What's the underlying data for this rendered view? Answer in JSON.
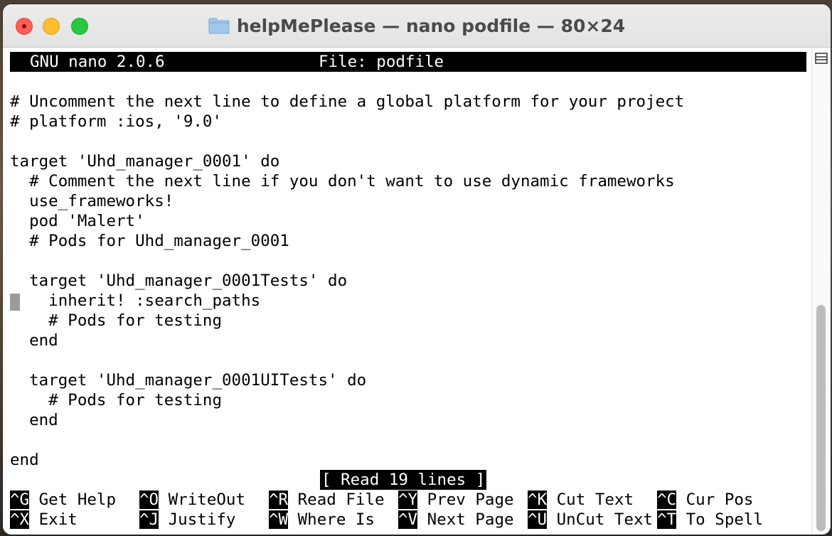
{
  "window": {
    "title": "helpMePlease — nano podfile — 80×24"
  },
  "nano": {
    "version": "GNU nano 2.0.6",
    "file": "File: podfile",
    "lines": [
      "",
      "# Uncomment the next line to define a global platform for your project",
      "# platform :ios, '9.0'",
      "",
      "target 'Uhd_manager_0001' do",
      "  # Comment the next line if you don't want to use dynamic frameworks",
      "  use_frameworks!",
      "  pod 'Malert'",
      "  # Pods for Uhd_manager_0001",
      "",
      "  target 'Uhd_manager_0001Tests' do",
      "    inherit! :search_paths",
      "    # Pods for testing",
      "  end",
      "",
      "  target 'Uhd_manager_0001UITests' do",
      "    # Pods for testing",
      "  end",
      "",
      "end"
    ],
    "status": "[ Read 19 lines ]",
    "shortcuts_row1": [
      {
        "key": "^G",
        "label": "Get Help"
      },
      {
        "key": "^O",
        "label": "WriteOut"
      },
      {
        "key": "^R",
        "label": "Read File"
      },
      {
        "key": "^Y",
        "label": "Prev Page"
      },
      {
        "key": "^K",
        "label": "Cut Text"
      },
      {
        "key": "^C",
        "label": "Cur Pos"
      }
    ],
    "shortcuts_row2": [
      {
        "key": "^X",
        "label": "Exit"
      },
      {
        "key": "^J",
        "label": "Justify"
      },
      {
        "key": "^W",
        "label": "Where Is"
      },
      {
        "key": "^V",
        "label": "Next Page"
      },
      {
        "key": "^U",
        "label": "UnCut Text"
      },
      {
        "key": "^T",
        "label": "To Spell"
      }
    ]
  },
  "colors": {
    "close": "#ff5f57",
    "minimize": "#febc2e",
    "maximize": "#28c840"
  },
  "icons": {
    "folder": "folder-icon",
    "menu": "menu-icon"
  }
}
